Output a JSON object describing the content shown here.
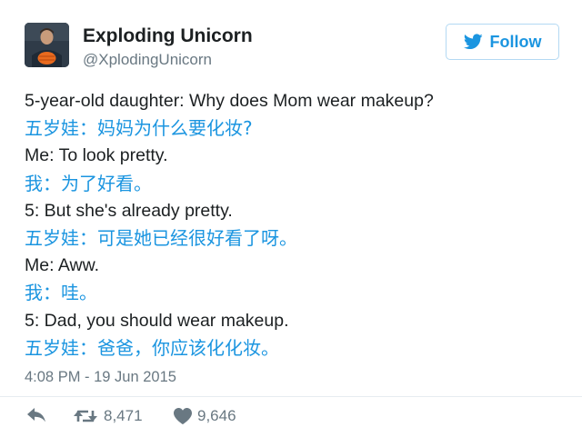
{
  "author": {
    "name": "Exploding Unicorn",
    "handle": "@XplodingUnicorn"
  },
  "follow_button": {
    "label": "Follow",
    "icon": "twitter-bird-icon",
    "color": "#1b95e0"
  },
  "tweet": {
    "lines": [
      {
        "lang": "en",
        "text": "5-year-old daughter: Why does Mom wear makeup?"
      },
      {
        "lang": "zh",
        "text": "五岁娃：妈妈为什么要化妆?"
      },
      {
        "lang": "en",
        "text": "Me: To look pretty."
      },
      {
        "lang": "zh",
        "text": "我：为了好看。"
      },
      {
        "lang": "en",
        "text": "5: But she's already pretty."
      },
      {
        "lang": "zh",
        "text": "五岁娃：可是她已经很好看了呀。"
      },
      {
        "lang": "en",
        "text": "Me: Aww."
      },
      {
        "lang": "zh",
        "text": "我：哇。"
      },
      {
        "lang": "en",
        "text": "5: Dad, you should wear makeup."
      },
      {
        "lang": "zh",
        "text": "五岁娃：爸爸，你应该化化妆。"
      }
    ],
    "timestamp": "4:08 PM - 19 Jun 2015"
  },
  "actions": {
    "reply": {
      "icon": "reply-icon"
    },
    "retweet": {
      "icon": "retweet-icon",
      "count": "8,471"
    },
    "like": {
      "icon": "heart-icon",
      "count": "9,646"
    }
  },
  "colors": {
    "link_blue": "#1b95e0",
    "text_dark": "#1c2022",
    "text_muted": "#697882"
  }
}
